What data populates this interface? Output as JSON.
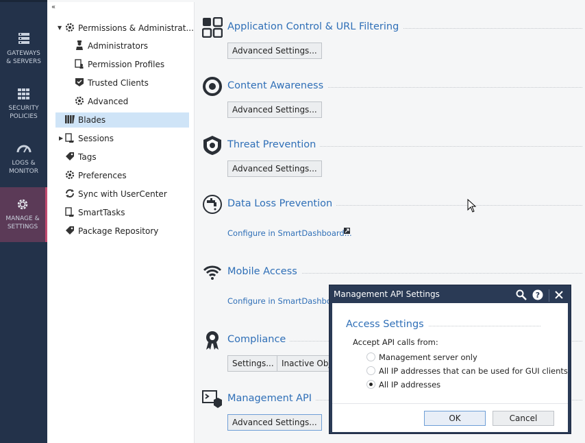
{
  "leftnav": {
    "items": [
      {
        "line1": "GATEWAYS",
        "line2": "& SERVERS",
        "icon": "gateways-icon"
      },
      {
        "line1": "SECURITY",
        "line2": "POLICIES",
        "icon": "policies-icon"
      },
      {
        "line1": "LOGS &",
        "line2": "MONITOR",
        "icon": "gauge-icon"
      },
      {
        "line1": "MANAGE &",
        "line2": "SETTINGS",
        "icon": "gear-icon"
      }
    ]
  },
  "tree": {
    "collapse_glyph": "«",
    "items": [
      {
        "label": "Permissions & Administrat..."
      },
      {
        "label": "Administrators"
      },
      {
        "label": "Permission Profiles"
      },
      {
        "label": "Trusted Clients"
      },
      {
        "label": "Advanced"
      },
      {
        "label": "Blades"
      },
      {
        "label": "Sessions"
      },
      {
        "label": "Tags"
      },
      {
        "label": "Preferences"
      },
      {
        "label": "Sync with UserCenter"
      },
      {
        "label": "SmartTasks"
      },
      {
        "label": "Package Repository"
      }
    ]
  },
  "blades": [
    {
      "title": "Application Control & URL Filtering",
      "button": "Advanced Settings..."
    },
    {
      "title": "Content Awareness",
      "button": "Advanced Settings..."
    },
    {
      "title": "Threat Prevention",
      "button": "Advanced Settings..."
    },
    {
      "title": "Data Loss Prevention",
      "link": "Configure in SmartDashboard..."
    },
    {
      "title": "Mobile Access",
      "link": "Configure in SmartDashboard..."
    },
    {
      "title": "Compliance",
      "button": "Settings...",
      "button2": "Inactive Obje"
    },
    {
      "title": "Management API",
      "button": "Advanced Settings..."
    }
  ],
  "dialog": {
    "title": "Management API Settings",
    "section": "Access Settings",
    "prompt": "Accept API calls from:",
    "options": [
      {
        "label": "Management server only",
        "checked": false
      },
      {
        "label": "All IP addresses that can be used for GUI clients",
        "checked": false
      },
      {
        "label": "All IP addresses",
        "checked": true
      }
    ],
    "ok": "OK",
    "cancel": "Cancel"
  }
}
